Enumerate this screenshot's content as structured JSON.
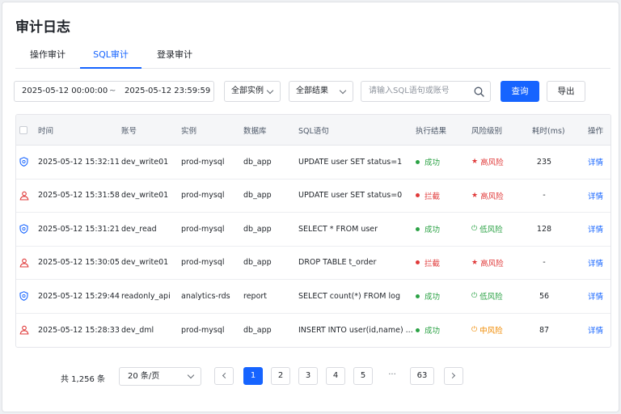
{
  "page": {
    "title": "审计日志"
  },
  "tabs": [
    {
      "label": "操作审计",
      "active": false
    },
    {
      "label": "SQL审计",
      "active": true
    },
    {
      "label": "登录审计",
      "active": false
    }
  ],
  "filters": {
    "start_time": "2025-05-12 00:00:00",
    "range_sep": "~",
    "end_time": "2025-05-12 23:59:59",
    "instance": "全部实例",
    "result": "全部结果",
    "search_placeholder": "请输入SQL语句或账号",
    "query_label": "查询",
    "export_label": "导出"
  },
  "colors": {
    "accent": "#1664ff",
    "success": "#2ba245",
    "blocked": "#e03a3a",
    "high_risk": "#e03a3a",
    "low_risk": "#2ba245",
    "mid_risk": "#f08a00"
  },
  "table": {
    "columns": [
      "时间",
      "账号",
      "实例",
      "数据库",
      "SQL语句",
      "执行结果",
      "风险级别",
      "耗时(ms)",
      "操作"
    ],
    "rows": [
      {
        "icon": "shield-check-icon",
        "time": "2025-05-12 15:32:11",
        "account": "dev_write01",
        "instance": "prod-mysql",
        "db": "db_app",
        "sql": "UPDATE user SET status=1",
        "result": "成功",
        "result_type": "success",
        "risk": "高风险",
        "risk_type": "high",
        "duration": "235",
        "action": "详情"
      },
      {
        "icon": "user-alert-icon",
        "time": "2025-05-12 15:31:58",
        "account": "dev_write01",
        "instance": "prod-mysql",
        "db": "db_app",
        "sql": "UPDATE user SET status=0",
        "result": "拦截",
        "result_type": "blocked",
        "risk": "高风险",
        "risk_type": "high",
        "duration": "-",
        "action": "详情"
      },
      {
        "icon": "shield-check-icon",
        "time": "2025-05-12 15:31:21",
        "account": "dev_read",
        "instance": "prod-mysql",
        "db": "db_app",
        "sql": "SELECT * FROM user",
        "result": "成功",
        "result_type": "success",
        "risk": "低风险",
        "risk_type": "low",
        "duration": "128",
        "action": "详情"
      },
      {
        "icon": "user-alert-icon",
        "time": "2025-05-12 15:30:05",
        "account": "dev_write01",
        "instance": "prod-mysql",
        "db": "db_app",
        "sql": "DROP TABLE t_order",
        "result": "拦截",
        "result_type": "blocked",
        "risk": "高风险",
        "risk_type": "high",
        "duration": "-",
        "action": "详情"
      },
      {
        "icon": "shield-check-icon",
        "time": "2025-05-12 15:29:44",
        "account": "readonly_api",
        "instance": "analytics-rds",
        "db": "report",
        "sql": "SELECT count(*) FROM log",
        "result": "成功",
        "result_type": "success",
        "risk": "低风险",
        "risk_type": "low",
        "duration": "56",
        "action": "详情"
      },
      {
        "icon": "user-alert-icon",
        "time": "2025-05-12 15:28:33",
        "account": "dev_dml",
        "instance": "prod-mysql",
        "db": "db_app",
        "sql": "INSERT INTO user(id,name) ...",
        "result": "成功",
        "result_type": "success",
        "risk": "中风险",
        "risk_type": "mid",
        "duration": "87",
        "action": "详情"
      }
    ]
  },
  "pagination": {
    "total": "共 1,256 条",
    "page_size": "20 条/页",
    "pages": [
      "1",
      "2",
      "3",
      "4",
      "5"
    ],
    "ellipsis": "···",
    "last_page": "63",
    "current": "1"
  }
}
